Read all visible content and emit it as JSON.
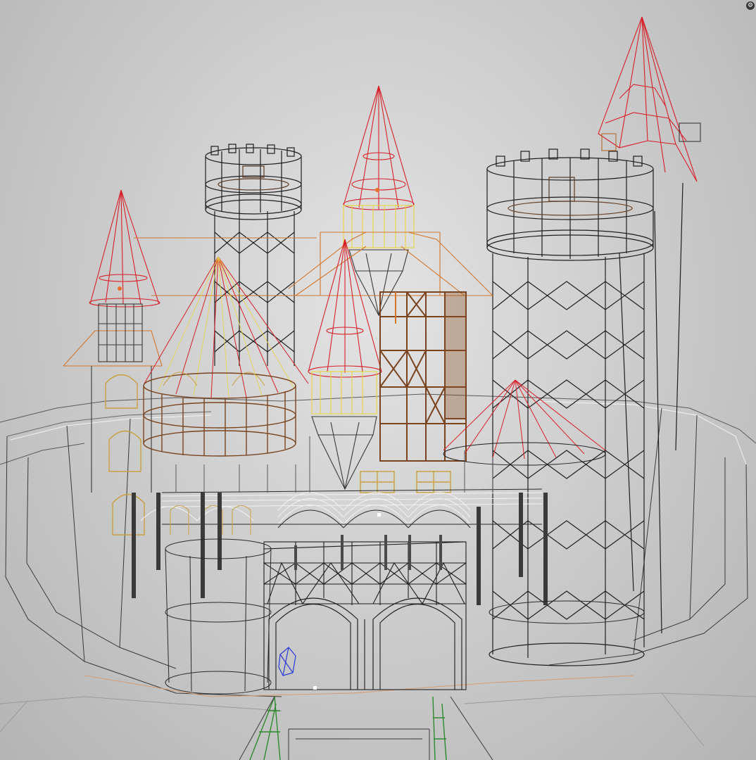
{
  "viewport": {
    "background_center": "#e3e3e3",
    "background_edge": "#b4b4b4"
  },
  "colors": {
    "wire_dark": "#1e1e1e",
    "wire_white": "#f4f4f4",
    "wire_red": "#d8202a",
    "wire_orange": "#d2762c",
    "wire_brown": "#7a4420",
    "wire_yellow": "#e8d640",
    "wire_green": "#2e8a2e",
    "wire_blue": "#2a3ad8"
  },
  "icons": {
    "corner_button": "gear-icon",
    "corner_glyph": "⚙"
  }
}
